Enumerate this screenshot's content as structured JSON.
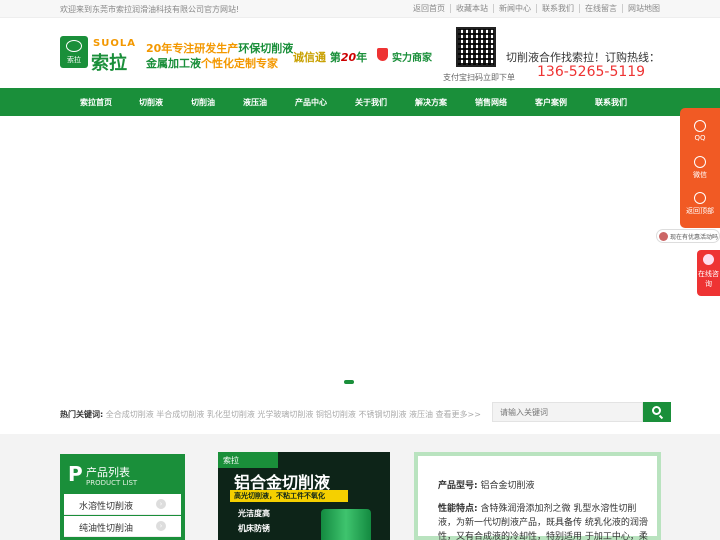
{
  "topbar": {
    "welcome": "欢迎来到东莞市索拉润滑油科技有限公司官方网站!",
    "links": [
      "返回首页",
      "收藏本站",
      "新闻中心",
      "联系我们",
      "在线留言",
      "网站地图"
    ]
  },
  "header": {
    "logo_sub": "索拉",
    "brand_en": "SUOLA",
    "brand_cn": "索拉",
    "slogan_line1_a": "20年专注研发生产",
    "slogan_line1_b": "环保切削液",
    "slogan_line2_a": "金属加工液",
    "slogan_line2_b": "个性化定制专家",
    "cert_a": "诚信通",
    "cert_b": " 第",
    "cert_num": "20",
    "cert_c": "年",
    "power": "实力商家",
    "qr_tip": "支付宝扫码立即下单",
    "hotline_title": "切削液合作找索拉！订购热线：",
    "hotline_phone": "136-5265-5119"
  },
  "nav": [
    "索拉首页",
    "切削液",
    "切削油",
    "液压油",
    "产品中心",
    "关于我们",
    "解决方案",
    "销售网络",
    "客户案例",
    "联系我们"
  ],
  "keywords": {
    "label": "热门关键词:",
    "text": "全合成切削液 半合成切削液 乳化型切削液 光学玻璃切削液 铜铝切削液 不锈钢切削液 液压油 查看更多>>"
  },
  "search": {
    "placeholder": "请输入关键词"
  },
  "product_list": {
    "p": "P",
    "title": "产品列表",
    "subtitle": "PRODUCT LIST",
    "items": [
      "水溶性切削液",
      "纯油性切削油"
    ]
  },
  "product_image": {
    "brand": "索拉",
    "name": "铝合金切削液",
    "strip": "高光切削液，不粘工件不氧化",
    "features": [
      "光洁度高",
      "机床防锈"
    ]
  },
  "product_detail": {
    "model_label": "产品型号:",
    "model_value": "铝合金切削液",
    "feature_label": "性能特点:",
    "feature_text": "含特殊润滑添加剂之微 乳型水溶性切削液，为新一代切削液产品，既具备传 统乳化液的润滑性，又有合成液的冷却性，特别适用 于加工中心，柔性制造系统的高速加工。"
  },
  "float": {
    "qq": "QQ",
    "wechat": "微信",
    "top": "返回顶部",
    "promo": "现在有优惠活动吗",
    "consult": "在线咨询"
  }
}
